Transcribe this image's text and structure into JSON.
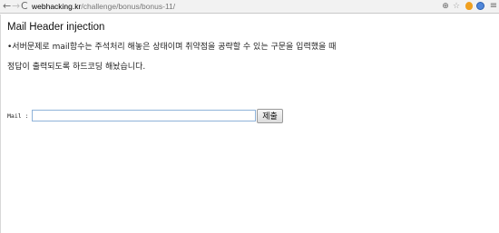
{
  "browser": {
    "url_scheme": "",
    "url_host": "webhacking.kr",
    "url_path": "/challenge/bonus/bonus-11/",
    "icons": [
      "back-icon",
      "forward-icon",
      "reload-icon",
      "zoom-icon",
      "star-icon",
      "extension-icon",
      "extension-icon",
      "menu-icon"
    ]
  },
  "page": {
    "title": "Mail Header injection",
    "description_line1": "•서버문제로 mail함수는 주석처리 해놓은 상태이며 취약점을 공략할 수 있는 구문을 입력했을 때",
    "description_line2": "정답이 출력되도록 하드코딩 해놨습니다."
  },
  "form": {
    "mail_label": "Mail :",
    "mail_value": "",
    "submit_label": "제출"
  }
}
